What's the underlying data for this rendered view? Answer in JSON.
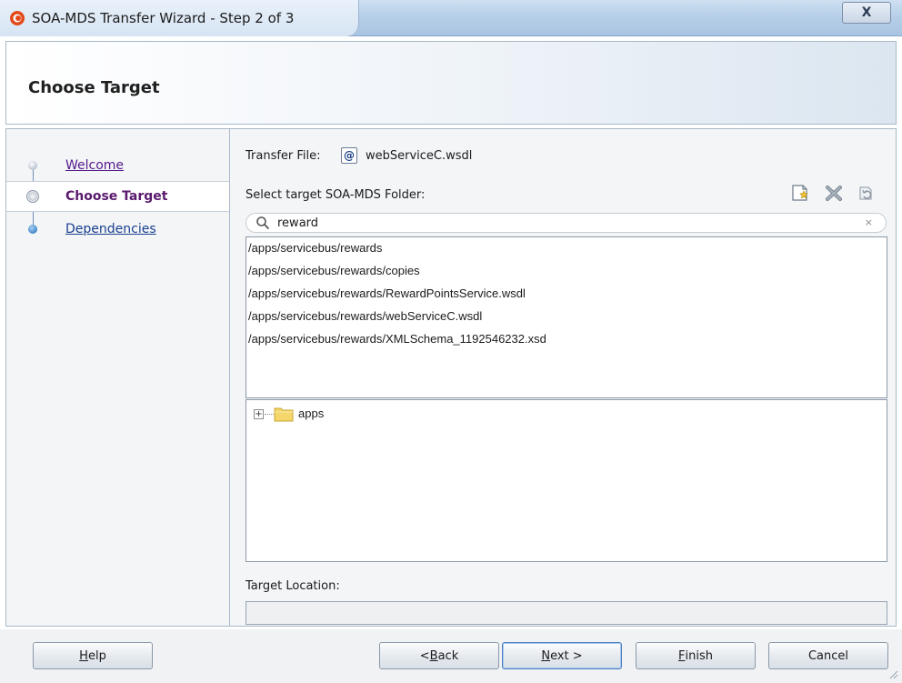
{
  "window": {
    "title": "SOA-MDS Transfer Wizard - Step 2 of 3",
    "close_glyph": "X"
  },
  "header": {
    "title": "Choose Target"
  },
  "nav": {
    "items": [
      {
        "label": "Welcome",
        "state": "visited"
      },
      {
        "label": "Choose Target",
        "state": "current"
      },
      {
        "label": "Dependencies",
        "state": "pending"
      }
    ]
  },
  "main": {
    "transfer_label": "Transfer File:",
    "transfer_icon": "@",
    "transfer_file": "webServiceC.wsdl",
    "select_label": "Select target SOA-MDS Folder:",
    "toolbar_icons": [
      "new-folder-icon",
      "delete-icon",
      "refresh-icon"
    ],
    "search": {
      "value": "reward",
      "clear_glyph": "×"
    },
    "results": [
      "/apps/servicebus/rewards",
      "/apps/servicebus/rewards/copies",
      "/apps/servicebus/rewards/RewardPointsService.wsdl",
      "/apps/servicebus/rewards/webServiceC.wsdl",
      "/apps/servicebus/rewards/XMLSchema_1192546232.xsd"
    ],
    "tree": {
      "expander": "+",
      "root": "apps"
    },
    "target_location_label": "Target Location:",
    "target_location_value": ""
  },
  "buttons": {
    "help": {
      "before": "",
      "mnemonic": "H",
      "after": "elp"
    },
    "back": {
      "before": "< ",
      "mnemonic": "B",
      "after": "ack"
    },
    "next": {
      "before": "",
      "mnemonic": "N",
      "after": "ext >"
    },
    "finish": {
      "before": "",
      "mnemonic": "F",
      "after": "inish"
    },
    "cancel": {
      "before": "",
      "mnemonic": "",
      "after": "Cancel"
    }
  },
  "colors": {
    "visited_link": "#551a8b",
    "current_step": "#5a1a6e",
    "pending_link": "#1b3f8f",
    "primary_button_border": "#4d7fbf"
  }
}
